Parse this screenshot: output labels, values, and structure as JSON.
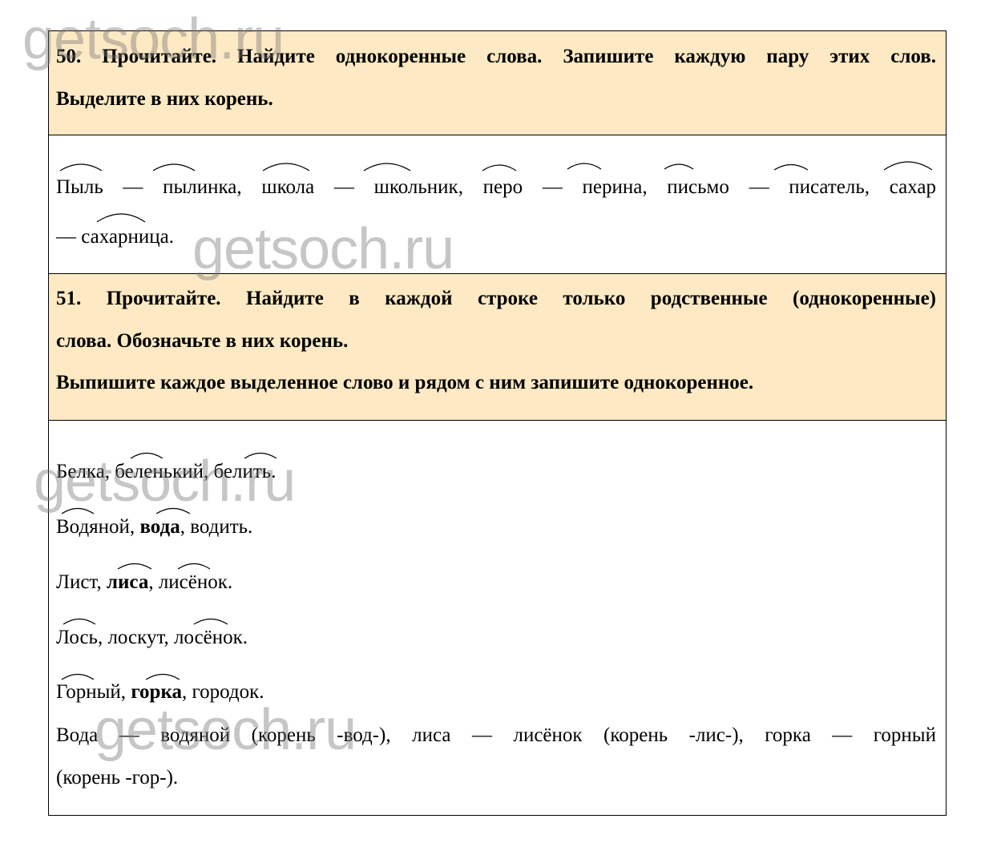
{
  "watermark": "getsoch.ru",
  "task50": {
    "lines": [
      "50. Прочитайте. Найдите однокоренные слова. Запишите каждую пару этих слов.",
      "Выделите в них корень."
    ]
  },
  "answer50": {
    "lines": [
      "Пыль — пылинка, школа — школьник, перо — перина, письмо — писатель, сахар",
      "— сахарница."
    ]
  },
  "task51": {
    "lines": [
      "51. Прочитайте. Найдите в каждой строке только родственные (однокоренные)",
      "слова. Обозначьте в них корень.",
      "Выпишите каждое выделенное слово и рядом с ним запишите однокоренное."
    ]
  },
  "answer51": {
    "rows": [
      {
        "pre": "Белка, беленький, белить.",
        "bold": "",
        "post": ""
      },
      {
        "pre": "Водяной, ",
        "bold": "вода",
        "post": ", водить."
      },
      {
        "pre": "Лист, ",
        "bold": "лиса",
        "post": ", лисёнок."
      },
      {
        "pre": "Лось, лоскут, лосёнок.",
        "bold": "",
        "post": ""
      },
      {
        "pre": "Горный, ",
        "bold": "горка",
        "post": ", городок."
      }
    ],
    "summary": [
      "Вода — водяной (корень -вод-), лиса — лисёнок (корень -лис-), горка — горный",
      "(корень -гор-)."
    ]
  },
  "colors": {
    "task_bg": "#fde9c3",
    "border": "#000000",
    "watermark": "#787878"
  }
}
